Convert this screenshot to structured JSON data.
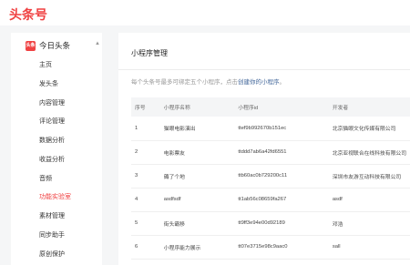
{
  "brand": {
    "logo": "头条号"
  },
  "sidebar": {
    "section_label": "今日头条",
    "section_icon": "头条",
    "items": [
      {
        "label": "主页"
      },
      {
        "label": "发头条"
      },
      {
        "label": "内容管理"
      },
      {
        "label": "评论管理"
      },
      {
        "label": "数据分析"
      },
      {
        "label": "收益分析"
      },
      {
        "label": "音频"
      },
      {
        "label": "功能实验室"
      },
      {
        "label": "素材管理"
      },
      {
        "label": "同步助手"
      },
      {
        "label": "原创保护"
      }
    ]
  },
  "main": {
    "title": "小程序管理",
    "notice_prefix": "每个头条号最多可绑定五个小程序，点击",
    "notice_link": "创建你的小程序",
    "notice_suffix": "。",
    "table": {
      "headers": [
        "序号",
        "小程序名称",
        "小程序id",
        "开发者"
      ],
      "rows": [
        [
          "1",
          "猫眼电影演出",
          "ttef9b992670b151ec",
          "北京猫眼文化传媒有限公司"
        ],
        [
          "2",
          "电影票友",
          "ttddd7ab6a42fd6551",
          "北京亚视联合在线科技有限公司"
        ],
        [
          "3",
          "薅了个地",
          "ttb60ac0b729200c11",
          "深圳市友游互动科技有限公司"
        ],
        [
          "4",
          "asdfsdf",
          "tt1ab56c08659fa267",
          "asdf"
        ],
        [
          "5",
          "街头霸移",
          "tt9ff3e94e00d92189",
          "邓浩"
        ],
        [
          "6",
          "小程序能力展示",
          "tt07e3715e98c9aac0",
          "sall"
        ]
      ]
    }
  }
}
